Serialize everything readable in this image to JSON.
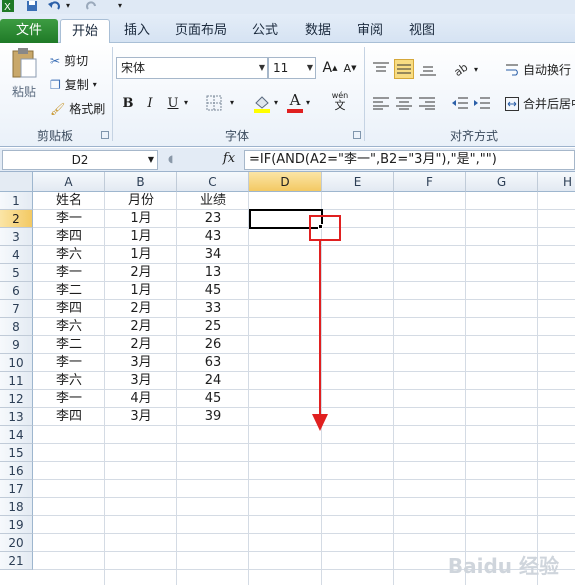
{
  "file_tab": "文件",
  "tabs": [
    {
      "label": "开始",
      "active": true
    },
    {
      "label": "插入"
    },
    {
      "label": "页面布局"
    },
    {
      "label": "公式"
    },
    {
      "label": "数据"
    },
    {
      "label": "审阅"
    },
    {
      "label": "视图"
    }
  ],
  "clipboard": {
    "paste": "粘贴",
    "cut": "剪切",
    "copy": "复制",
    "format_painter": "格式刷",
    "group_label": "剪贴板"
  },
  "font": {
    "name": "宋体",
    "size": "11",
    "bold": "B",
    "italic": "I",
    "underline": "U",
    "wen": "wén",
    "wen_char": "文",
    "font_color_letter": "A",
    "grow": "A",
    "shrink": "A",
    "group_label": "字体"
  },
  "alignment": {
    "wrap_text": "自动换行",
    "merge_center": "合并后居中",
    "group_label": "对齐方式"
  },
  "formula_bar": {
    "name_box": "D2",
    "fx": "fx",
    "formula": "=IF(AND(A2=\"李一\",B2=\"3月\"),\"是\",\"\")"
  },
  "columns": [
    "A",
    "B",
    "C",
    "D",
    "E",
    "F",
    "G",
    "H"
  ],
  "row_numbers": [
    "1",
    "2",
    "3",
    "4",
    "5",
    "6",
    "7",
    "8",
    "9",
    "10",
    "11",
    "12",
    "13",
    "14",
    "15",
    "16",
    "17",
    "18",
    "19",
    "20",
    "21"
  ],
  "table": {
    "headers": [
      "姓名",
      "月份",
      "业绩"
    ],
    "rows": [
      [
        "李一",
        "1月",
        "23"
      ],
      [
        "李四",
        "1月",
        "43"
      ],
      [
        "李六",
        "1月",
        "34"
      ],
      [
        "李一",
        "2月",
        "13"
      ],
      [
        "李二",
        "1月",
        "45"
      ],
      [
        "李四",
        "2月",
        "33"
      ],
      [
        "李六",
        "2月",
        "25"
      ],
      [
        "李二",
        "2月",
        "26"
      ],
      [
        "李一",
        "3月",
        "63"
      ],
      [
        "李六",
        "3月",
        "24"
      ],
      [
        "李一",
        "4月",
        "45"
      ],
      [
        "李四",
        "3月",
        "39"
      ]
    ]
  },
  "selected_cell": "D2",
  "annotation_color": "#e02020",
  "watermark": "Baidu 经验"
}
